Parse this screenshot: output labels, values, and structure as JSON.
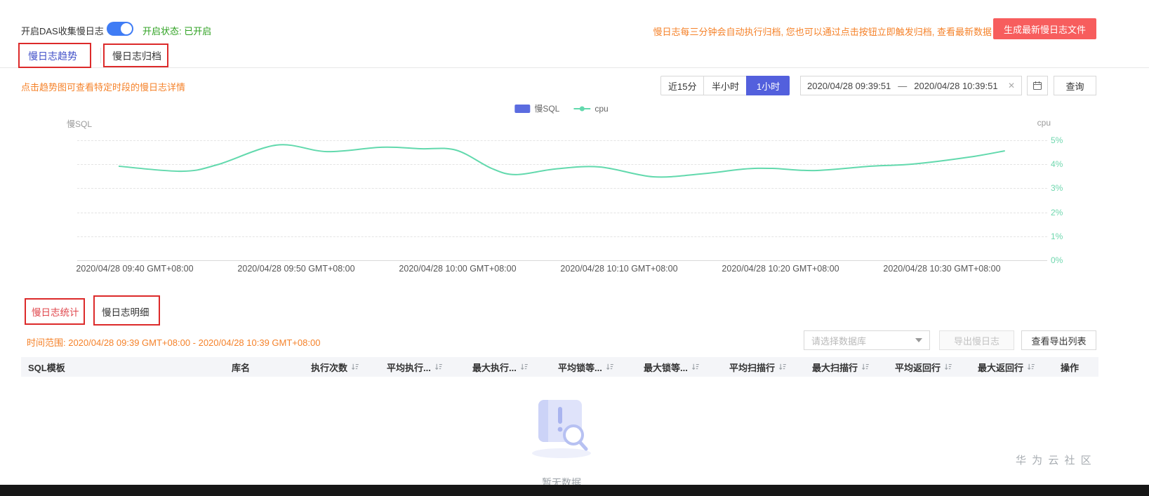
{
  "topbar": {
    "toggle_label": "开启DAS收集慢日志",
    "status_text": "开启状态: 已开启",
    "notice": "慢日志每三分钟会自动执行归档, 您也可以通过点击按钮立即触发归档, 查看最新数据",
    "generate_button": "生成最新慢日志文件"
  },
  "tabs": {
    "trend": "慢日志趋势",
    "archive": "慢日志归档"
  },
  "trend_section": {
    "hint": "点击趋势图可查看特定时段的慢日志详情",
    "range_buttons": [
      "近15分",
      "半小时",
      "1小时"
    ],
    "active_range": "1小时",
    "date_start": "2020/04/28 09:39:51",
    "date_sep": "—",
    "date_end": "2020/04/28 10:39:51",
    "clear_icon": "✕",
    "query_button": "查询"
  },
  "chart_data": {
    "type": "line",
    "left_axis_label": "慢SQL",
    "right_axis_label": "cpu",
    "legend": [
      {
        "name": "慢SQL",
        "color": "#5b6ce0",
        "marker": "rect"
      },
      {
        "name": "cpu",
        "color": "#62d9ad",
        "marker": "line-dot"
      }
    ],
    "right_ticks": [
      "5%",
      "4%",
      "3%",
      "2%",
      "1%",
      "0%"
    ],
    "right_axis_range": [
      0,
      5
    ],
    "grid": "dashed-horizontal",
    "x_ticks": [
      "2020/04/28 09:40 GMT+08:00",
      "2020/04/28 09:50 GMT+08:00",
      "2020/04/28 10:00 GMT+08:00",
      "2020/04/28 10:10 GMT+08:00",
      "2020/04/28 10:20 GMT+08:00",
      "2020/04/28 10:30 GMT+08:00"
    ],
    "series": [
      {
        "name": "cpu",
        "unit": "%",
        "t_minutes": [
          0,
          3.9,
          6.1,
          9.8,
          12.9,
          16.3,
          18.7,
          20.9,
          23.1,
          24.6,
          27,
          29.8,
          33.1,
          36.1,
          38.7,
          40.5,
          43.1,
          46.6,
          49.2,
          52.7,
          54.9
        ],
        "values": [
          3.92,
          3.71,
          3.98,
          4.8,
          4.53,
          4.71,
          4.65,
          4.59,
          3.83,
          3.57,
          3.8,
          3.89,
          3.48,
          3.6,
          3.8,
          3.83,
          3.74,
          3.92,
          4.01,
          4.3,
          4.56
        ]
      },
      {
        "name": "慢SQL",
        "type": "bar",
        "values": []
      }
    ]
  },
  "stats_section": {
    "tab_stats": "慢日志统计",
    "tab_detail": "慢日志明细",
    "time_range": "时间范围: 2020/04/28 09:39 GMT+08:00 - 2020/04/28 10:39 GMT+08:00",
    "db_placeholder": "请选择数据库",
    "export_button": "导出慢日志",
    "view_export_button": "查看导出列表",
    "columns": [
      {
        "label": "SQL模板",
        "sortable": false
      },
      {
        "label": "库名",
        "sortable": false
      },
      {
        "label": "执行次数",
        "sortable": true
      },
      {
        "label": "平均执行...",
        "sortable": true
      },
      {
        "label": "最大执行...",
        "sortable": true
      },
      {
        "label": "平均锁等...",
        "sortable": true
      },
      {
        "label": "最大锁等...",
        "sortable": true
      },
      {
        "label": "平均扫描行",
        "sortable": true
      },
      {
        "label": "最大扫描行",
        "sortable": true
      },
      {
        "label": "平均返回行",
        "sortable": true
      },
      {
        "label": "最大返回行",
        "sortable": true
      },
      {
        "label": "操作",
        "sortable": false
      }
    ],
    "empty_text": "暂无数据"
  },
  "watermark": "华 为 云 社 区",
  "colors": {
    "accent_blue": "#5360dd",
    "toggle_blue": "#3f7cf5",
    "status_green": "#2ea121",
    "orange": "#f5822a",
    "danger_red": "#f75d5d",
    "line_green": "#62d9ad",
    "tick_green": "#6fd7ae",
    "tab_active_blue": "#4150c8",
    "stats_tab_red": "#e0484e",
    "annotation_red": "#dc2a2a"
  }
}
